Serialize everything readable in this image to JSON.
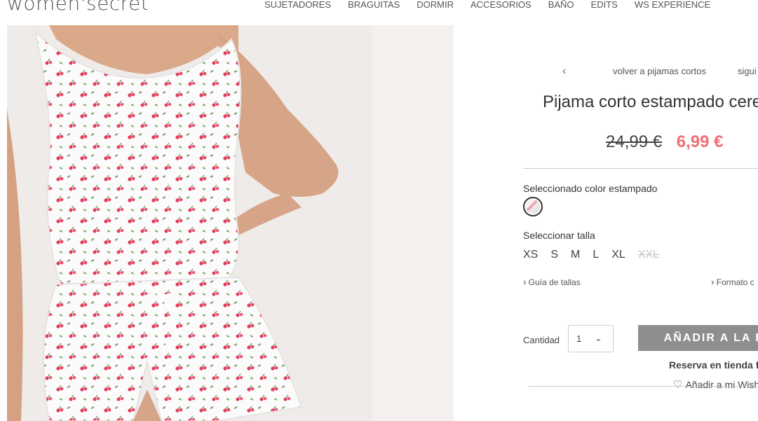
{
  "header": {
    "logo": "women'secret",
    "nav": [
      "SUJETADORES",
      "BRAGUITAS",
      "DORMIR",
      "ACCESORIOS",
      "BAÑO",
      "EDITS",
      "WS EXPERIENCE"
    ]
  },
  "product": {
    "prev_icon": "chevron-left-icon",
    "back_label": "volver a pijamas cortos",
    "next_label": "sigui",
    "title": "Pijama corto estampado cere",
    "old_price": "24,99 €",
    "new_price": "6,99 €",
    "color_label": "Seleccionado color estampado",
    "size_label": "Seleccionar talla",
    "sizes": [
      "XS",
      "S",
      "M",
      "L",
      "XL",
      "XXL"
    ],
    "size_guide": "Guía de tallas",
    "format": "Formato c",
    "qty_label": "Cantidad",
    "qty_value": "1",
    "add_button": "AÑADIR A LA BO",
    "reserve": "Reserva en tienda f",
    "wishlist": "Añadir a mi Wish",
    "colors": {
      "sale": "#ef6f74",
      "button": "#8e8e8e"
    }
  }
}
